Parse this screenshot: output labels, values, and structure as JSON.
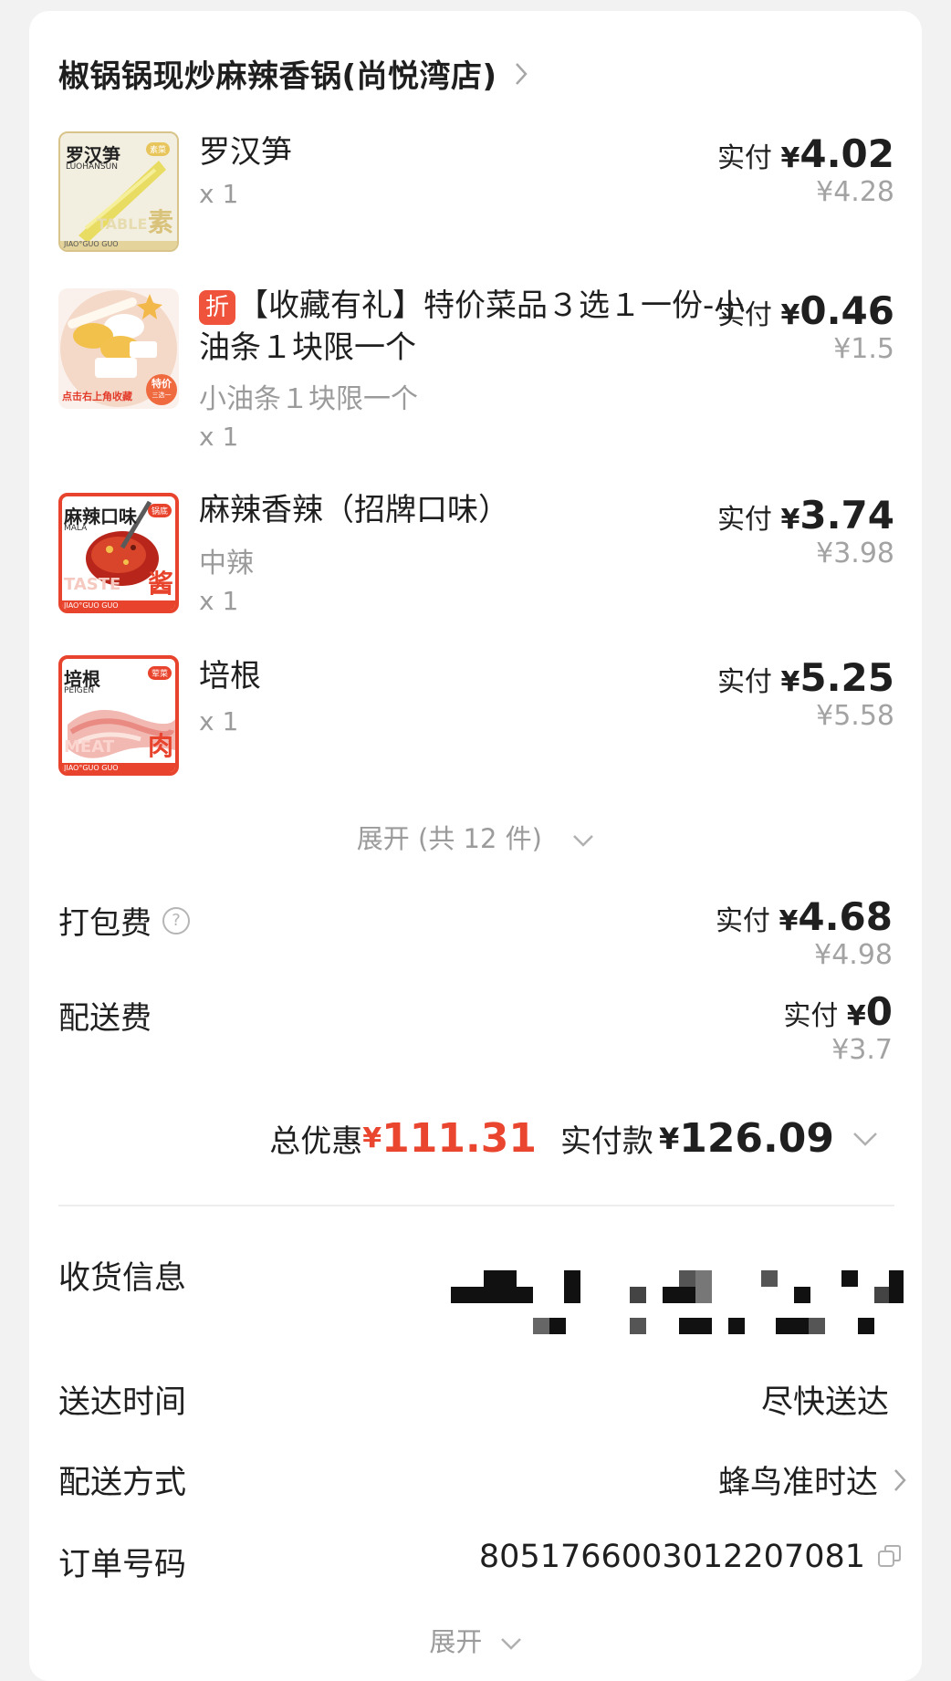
{
  "shop": {
    "name": "椒锅锅现炒麻辣香锅(尚悦湾店)"
  },
  "price_prefix": "实付",
  "currency": "¥",
  "items": [
    {
      "name": "罗汉笋",
      "spec": "",
      "qty": "x 1",
      "paid": "4.02",
      "original": "¥4.28",
      "thumb": {
        "title": "罗汉笋",
        "sub": "LUOHANSUN",
        "badge": "素菜",
        "watermark": "TABLE",
        "char": "素",
        "footer": "JIAO°GUO GUO"
      }
    },
    {
      "tag": "折",
      "name": "【收藏有礼】特价菜品３选１一份-小油条１块限一个",
      "spec": "小油条１块限一个",
      "qty": "x 1",
      "paid": "0.46",
      "original": "¥1.5",
      "thumb": {
        "caption": "点击右上角收藏",
        "badge": "特价",
        "badge_sub": "三选一"
      }
    },
    {
      "name": "麻辣香辣（招牌口味）",
      "spec": "中辣",
      "qty": "x 1",
      "paid": "3.74",
      "original": "¥3.98",
      "thumb": {
        "title": "麻辣口味",
        "sub": "MALA",
        "badge": "锅底",
        "watermark": "TASTE",
        "char": "酱",
        "footer": "JIAO°GUO GUO"
      }
    },
    {
      "name": "培根",
      "spec": "",
      "qty": "x 1",
      "paid": "5.25",
      "original": "¥5.58",
      "thumb": {
        "title": "培根",
        "sub": "PEIGEN",
        "badge": "荤菜",
        "watermark": "MEAT",
        "char": "肉",
        "footer": "JIAO°GUO GUO"
      }
    }
  ],
  "expand_items": "展开 (共 12 件)",
  "fees": [
    {
      "label": "打包费",
      "help": "?",
      "paid": "4.68",
      "original": "¥4.98"
    },
    {
      "label": "配送费",
      "paid": "0",
      "original": "¥3.7"
    }
  ],
  "totals": {
    "discount_label": "总优惠",
    "discount_currency": "¥",
    "discount": "111.31",
    "paid_label": "实付款",
    "paid_currency": "¥",
    "paid": "126.09"
  },
  "info": {
    "address_label": "收货信息",
    "delivery_time_label": "送达时间",
    "delivery_time": "尽快送达",
    "method_label": "配送方式",
    "method": "蜂鸟准时达",
    "order_label": "订单号码",
    "order_no": "8051766003012207081"
  },
  "expand_more": "展开",
  "colors": {
    "accent_red": "#e9452f",
    "thumb_red": "#e8432c",
    "tag": "#f0533b"
  }
}
